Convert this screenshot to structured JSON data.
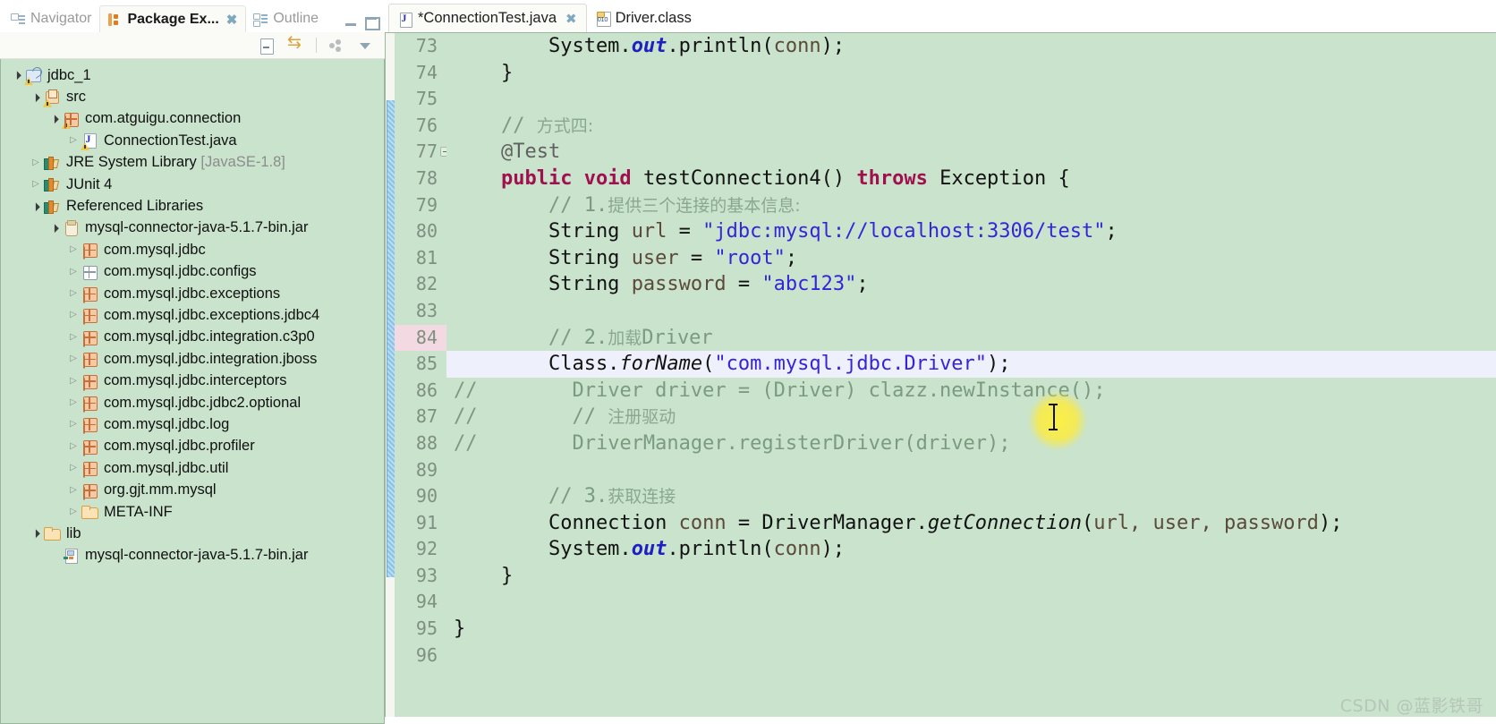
{
  "left_panel": {
    "view_tabs": [
      {
        "label": "Navigator",
        "icon": "navigator-icon",
        "active": false,
        "closable": false
      },
      {
        "label": "Package Ex...",
        "icon": "package-explorer-icon",
        "active": true,
        "closable": true
      },
      {
        "label": "Outline",
        "icon": "outline-icon",
        "active": false,
        "closable": false
      }
    ],
    "window_buttons": [
      {
        "name": "minimize-view-button",
        "glyph": "minimize"
      },
      {
        "name": "maximize-view-button",
        "glyph": "maximize"
      }
    ],
    "toolbar": [
      {
        "name": "collapse-all-button",
        "icon": "collapse-all-icon"
      },
      {
        "name": "link-with-editor-button",
        "icon": "link-editor-icon"
      },
      {
        "name": "view-menu-button",
        "icon": "view-menu-icon"
      },
      {
        "name": "view-menu-chevron",
        "icon": "chevron-down-icon"
      }
    ],
    "tree": [
      {
        "indent": 0,
        "twist": "open",
        "icon": "java-project",
        "label": "jdbc_1",
        "warn": true
      },
      {
        "indent": 1,
        "twist": "open",
        "icon": "source-folder",
        "label": "src",
        "warn": true
      },
      {
        "indent": 2,
        "twist": "open",
        "icon": "package",
        "label": "com.atguigu.connection",
        "warn": true
      },
      {
        "indent": 3,
        "twist": "closed",
        "icon": "java-file",
        "label": "ConnectionTest.java",
        "warn": true
      },
      {
        "indent": 1,
        "twist": "closed",
        "icon": "library",
        "label": "JRE System Library ",
        "suffix": "[JavaSE-1.8]"
      },
      {
        "indent": 1,
        "twist": "closed",
        "icon": "library",
        "label": "JUnit 4"
      },
      {
        "indent": 1,
        "twist": "open",
        "icon": "library",
        "label": "Referenced Libraries"
      },
      {
        "indent": 2,
        "twist": "open",
        "icon": "jar",
        "label": "mysql-connector-java-5.1.7-bin.jar"
      },
      {
        "indent": 3,
        "twist": "closed",
        "icon": "package",
        "label": "com.mysql.jdbc"
      },
      {
        "indent": 3,
        "twist": "closed",
        "icon": "package-empty",
        "label": "com.mysql.jdbc.configs"
      },
      {
        "indent": 3,
        "twist": "closed",
        "icon": "package",
        "label": "com.mysql.jdbc.exceptions"
      },
      {
        "indent": 3,
        "twist": "closed",
        "icon": "package",
        "label": "com.mysql.jdbc.exceptions.jdbc4"
      },
      {
        "indent": 3,
        "twist": "closed",
        "icon": "package",
        "label": "com.mysql.jdbc.integration.c3p0"
      },
      {
        "indent": 3,
        "twist": "closed",
        "icon": "package",
        "label": "com.mysql.jdbc.integration.jboss"
      },
      {
        "indent": 3,
        "twist": "closed",
        "icon": "package",
        "label": "com.mysql.jdbc.interceptors"
      },
      {
        "indent": 3,
        "twist": "closed",
        "icon": "package",
        "label": "com.mysql.jdbc.jdbc2.optional"
      },
      {
        "indent": 3,
        "twist": "closed",
        "icon": "package",
        "label": "com.mysql.jdbc.log"
      },
      {
        "indent": 3,
        "twist": "closed",
        "icon": "package",
        "label": "com.mysql.jdbc.profiler"
      },
      {
        "indent": 3,
        "twist": "closed",
        "icon": "package",
        "label": "com.mysql.jdbc.util"
      },
      {
        "indent": 3,
        "twist": "closed",
        "icon": "package",
        "label": "org.gjt.mm.mysql"
      },
      {
        "indent": 3,
        "twist": "closed",
        "icon": "folder",
        "label": "META-INF"
      },
      {
        "indent": 1,
        "twist": "open",
        "icon": "folder",
        "label": "lib"
      },
      {
        "indent": 2,
        "twist": "none",
        "icon": "jar-file",
        "label": "mysql-connector-java-5.1.7-bin.jar"
      }
    ]
  },
  "editor": {
    "tabs": [
      {
        "label": "*ConnectionTest.java",
        "icon": "java-file-icon",
        "active": true,
        "dirty": true,
        "closable": true
      },
      {
        "label": "Driver.class",
        "icon": "class-file-icon",
        "active": false,
        "dirty": false,
        "closable": false
      }
    ],
    "first_visible_line": 73,
    "last_visible_line": 96,
    "current_line": 85,
    "changed_lines": [
      84
    ],
    "folding_markers": [
      77
    ],
    "lines": [
      {
        "n": 73,
        "segments": [
          {
            "t": "        System.",
            "c": "plain"
          },
          {
            "t": "out",
            "c": "field"
          },
          {
            "t": ".println(",
            "c": "plain"
          },
          {
            "t": "conn",
            "c": "var"
          },
          {
            "t": ");",
            "c": "plain"
          }
        ]
      },
      {
        "n": 74,
        "segments": [
          {
            "t": "    }",
            "c": "plain"
          }
        ]
      },
      {
        "n": 75,
        "segments": [
          {
            "t": "",
            "c": "plain"
          }
        ]
      },
      {
        "n": 76,
        "segments": [
          {
            "t": "    // ",
            "c": "com"
          },
          {
            "t": "方式四:",
            "c": "comzh"
          }
        ]
      },
      {
        "n": 77,
        "segments": [
          {
            "t": "    @Test",
            "c": "ann"
          }
        ]
      },
      {
        "n": 78,
        "segments": [
          {
            "t": "    ",
            "c": "plain"
          },
          {
            "t": "public void ",
            "c": "kw"
          },
          {
            "t": "testConnection4() ",
            "c": "plain"
          },
          {
            "t": "throws ",
            "c": "kw"
          },
          {
            "t": "Exception {",
            "c": "plain"
          }
        ]
      },
      {
        "n": 79,
        "segments": [
          {
            "t": "        // 1.",
            "c": "com"
          },
          {
            "t": "提供三个连接的基本信息:",
            "c": "comzh"
          }
        ]
      },
      {
        "n": 80,
        "segments": [
          {
            "t": "        String ",
            "c": "plain"
          },
          {
            "t": "url ",
            "c": "var"
          },
          {
            "t": "= ",
            "c": "plain"
          },
          {
            "t": "\"jdbc:mysql://localhost:3306/test\"",
            "c": "str"
          },
          {
            "t": ";",
            "c": "plain"
          }
        ]
      },
      {
        "n": 81,
        "segments": [
          {
            "t": "        String ",
            "c": "plain"
          },
          {
            "t": "user ",
            "c": "var"
          },
          {
            "t": "= ",
            "c": "plain"
          },
          {
            "t": "\"root\"",
            "c": "str"
          },
          {
            "t": ";",
            "c": "plain"
          }
        ]
      },
      {
        "n": 82,
        "segments": [
          {
            "t": "        String ",
            "c": "plain"
          },
          {
            "t": "password ",
            "c": "var"
          },
          {
            "t": "= ",
            "c": "plain"
          },
          {
            "t": "\"abc123\"",
            "c": "str"
          },
          {
            "t": ";",
            "c": "plain"
          }
        ]
      },
      {
        "n": 83,
        "segments": [
          {
            "t": "",
            "c": "plain"
          }
        ]
      },
      {
        "n": 84,
        "segments": [
          {
            "t": "        // 2.",
            "c": "com"
          },
          {
            "t": "加载",
            "c": "comzh"
          },
          {
            "t": "Driver",
            "c": "com"
          }
        ]
      },
      {
        "n": 85,
        "segments": [
          {
            "t": "        Class.",
            "c": "plain"
          },
          {
            "t": "forName",
            "c": "method"
          },
          {
            "t": "(",
            "c": "plain"
          },
          {
            "t": "\"com.mysql.jdbc.Driver\"",
            "c": "str"
          },
          {
            "t": ");",
            "c": "plain"
          }
        ]
      },
      {
        "n": 86,
        "prefix": "//",
        "segments": [
          {
            "t": "        Driver driver = (Driver) clazz.newInstance();",
            "c": "com"
          }
        ]
      },
      {
        "n": 87,
        "prefix": "//",
        "segments": [
          {
            "t": "        // ",
            "c": "com"
          },
          {
            "t": "注册驱动",
            "c": "comzh"
          }
        ]
      },
      {
        "n": 88,
        "prefix": "//",
        "segments": [
          {
            "t": "        DriverManager.registerDriver(driver);",
            "c": "com"
          }
        ]
      },
      {
        "n": 89,
        "segments": [
          {
            "t": "",
            "c": "plain"
          }
        ]
      },
      {
        "n": 90,
        "segments": [
          {
            "t": "        // 3.",
            "c": "com"
          },
          {
            "t": "获取连接",
            "c": "comzh"
          }
        ]
      },
      {
        "n": 91,
        "segments": [
          {
            "t": "        Connection ",
            "c": "plain"
          },
          {
            "t": "conn ",
            "c": "var"
          },
          {
            "t": "= DriverManager.",
            "c": "plain"
          },
          {
            "t": "getConnection",
            "c": "method"
          },
          {
            "t": "(",
            "c": "plain"
          },
          {
            "t": "url, user, password",
            "c": "var"
          },
          {
            "t": ");",
            "c": "plain"
          }
        ]
      },
      {
        "n": 92,
        "segments": [
          {
            "t": "        System.",
            "c": "plain"
          },
          {
            "t": "out",
            "c": "field"
          },
          {
            "t": ".println(",
            "c": "plain"
          },
          {
            "t": "conn",
            "c": "var"
          },
          {
            "t": ");",
            "c": "plain"
          }
        ]
      },
      {
        "n": 93,
        "segments": [
          {
            "t": "    }",
            "c": "plain"
          }
        ]
      },
      {
        "n": 94,
        "segments": [
          {
            "t": "",
            "c": "plain"
          }
        ]
      },
      {
        "n": 95,
        "segments": [
          {
            "t": "}",
            "c": "plain"
          }
        ]
      },
      {
        "n": 96,
        "segments": [
          {
            "t": "",
            "c": "plain"
          }
        ]
      }
    ]
  },
  "watermark": {
    "text": "CSDN @蓝影铁哥"
  },
  "colors": {
    "editor_background": "#c9e3cc",
    "tree_background": "#c9e3cc",
    "current_line": "#eef0fb",
    "changed_line_number": "#f2d9e2",
    "change_bar": "#8cc1e6",
    "keyword": "#a0104e",
    "string": "#3524d8",
    "comment": "#7b9b7f",
    "static_field": "#2020c0",
    "line_number": "#7f8f80",
    "cursor_highlight": "#fff03c"
  }
}
